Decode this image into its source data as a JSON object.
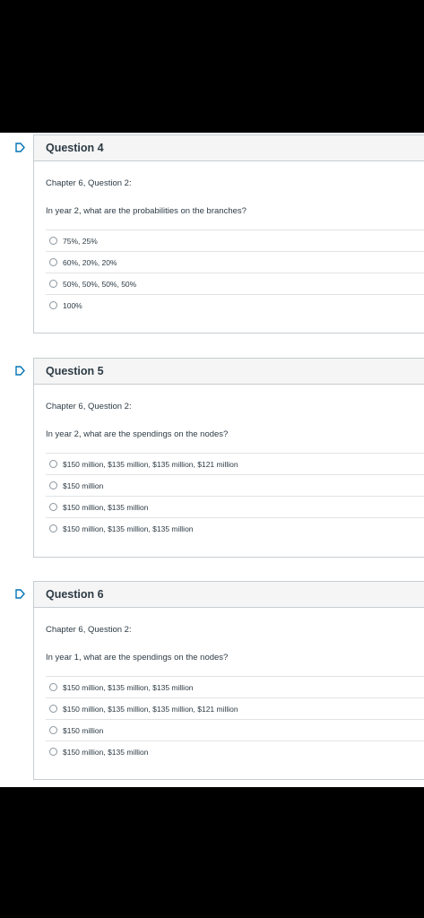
{
  "questions": [
    {
      "title": "Question 4",
      "chapter": "Chapter 6, Question 2:",
      "text": "In year 2, what are the probabilities on the branches?",
      "answers": [
        "75%, 25%",
        "60%, 20%, 20%",
        "50%, 50%, 50%, 50%",
        "100%"
      ]
    },
    {
      "title": "Question 5",
      "chapter": "Chapter 6, Question 2:",
      "text": "In year 2, what are the spendings on the nodes?",
      "answers": [
        "$150 million, $135 million, $135 million, $121 million",
        "$150 million",
        "$150 million, $135 million",
        "$150 million, $135 million, $135 million"
      ]
    },
    {
      "title": "Question 6",
      "chapter": "Chapter 6, Question 2:",
      "text": "In year 1, what are the spendings on the nodes?",
      "answers": [
        "$150 million, $135 million, $135 million",
        "$150 million, $135 million, $135 million, $121 million",
        "$150 million",
        "$150 million, $135 million"
      ]
    }
  ],
  "colors": {
    "accent": "#0374b5",
    "text": "#2d3b45",
    "border": "#c7cdd1"
  },
  "icons": {
    "flag": "bookmark-flag-icon",
    "radio": "radio-button-icon"
  }
}
